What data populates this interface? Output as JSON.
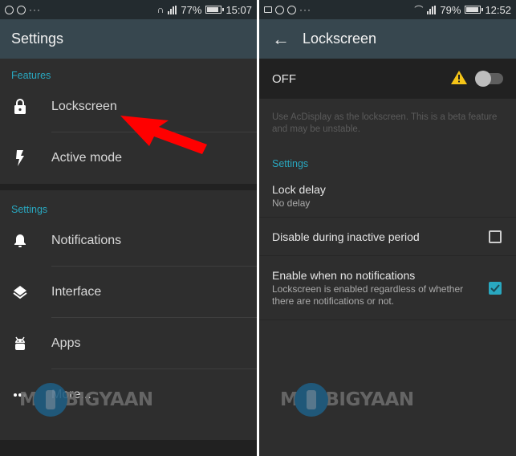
{
  "left_screen": {
    "status_bar": {
      "left_icons": [
        "sync-icon",
        "whatsapp-icon",
        "more-notifications-icon"
      ],
      "right_icons": [
        "headphones-icon",
        "signal-icon"
      ],
      "battery": "77%",
      "time": "15:07"
    },
    "app_bar": {
      "title": "Settings"
    },
    "sections": [
      {
        "header": "Features",
        "items": [
          {
            "label": "Lockscreen",
            "icon": "lock-icon"
          },
          {
            "label": "Active mode",
            "icon": "flash-icon"
          }
        ]
      },
      {
        "header": "Settings",
        "items": [
          {
            "label": "Notifications",
            "icon": "bell-icon"
          },
          {
            "label": "Interface",
            "icon": "layers-icon"
          },
          {
            "label": "Apps",
            "icon": "android-icon"
          },
          {
            "label": "More...",
            "icon": "more-horizontal-icon"
          }
        ]
      }
    ],
    "annotation": "red-arrow-pointing-to-lockscreen"
  },
  "right_screen": {
    "status_bar": {
      "left_icons": [
        "gallery-icon",
        "sync-icon",
        "whatsapp-icon",
        "more-notifications-icon"
      ],
      "right_icons": [
        "wifi-icon",
        "signal-icon"
      ],
      "battery": "79%",
      "time": "12:52"
    },
    "app_bar": {
      "title": "Lockscreen",
      "back_icon": "arrow-back-icon"
    },
    "master_switch": {
      "label": "OFF",
      "enabled": false,
      "warning_icon": "warning-icon"
    },
    "description": "Use AcDisplay as the lockscreen. This is a beta feature and may be unstable.",
    "section_header": "Settings",
    "preferences": [
      {
        "title": "Lock delay",
        "summary": "No delay",
        "type": "list"
      },
      {
        "title": "Disable during inactive period",
        "summary": "",
        "type": "checkbox",
        "checked": false
      },
      {
        "title": "Enable when no notifications",
        "summary": "Lockscreen is enabled regardless of whether there are notifications or not.",
        "type": "checkbox",
        "checked": true
      }
    ]
  },
  "watermark": {
    "text_before": "M",
    "text_after": "BIGYAAN"
  },
  "colors": {
    "accent": "#29a8c0",
    "app_bar": "#37474f",
    "status_bar": "#232b2f",
    "background": "#2e2e2e",
    "warning": "#f5c518",
    "arrow": "#ff0000"
  }
}
